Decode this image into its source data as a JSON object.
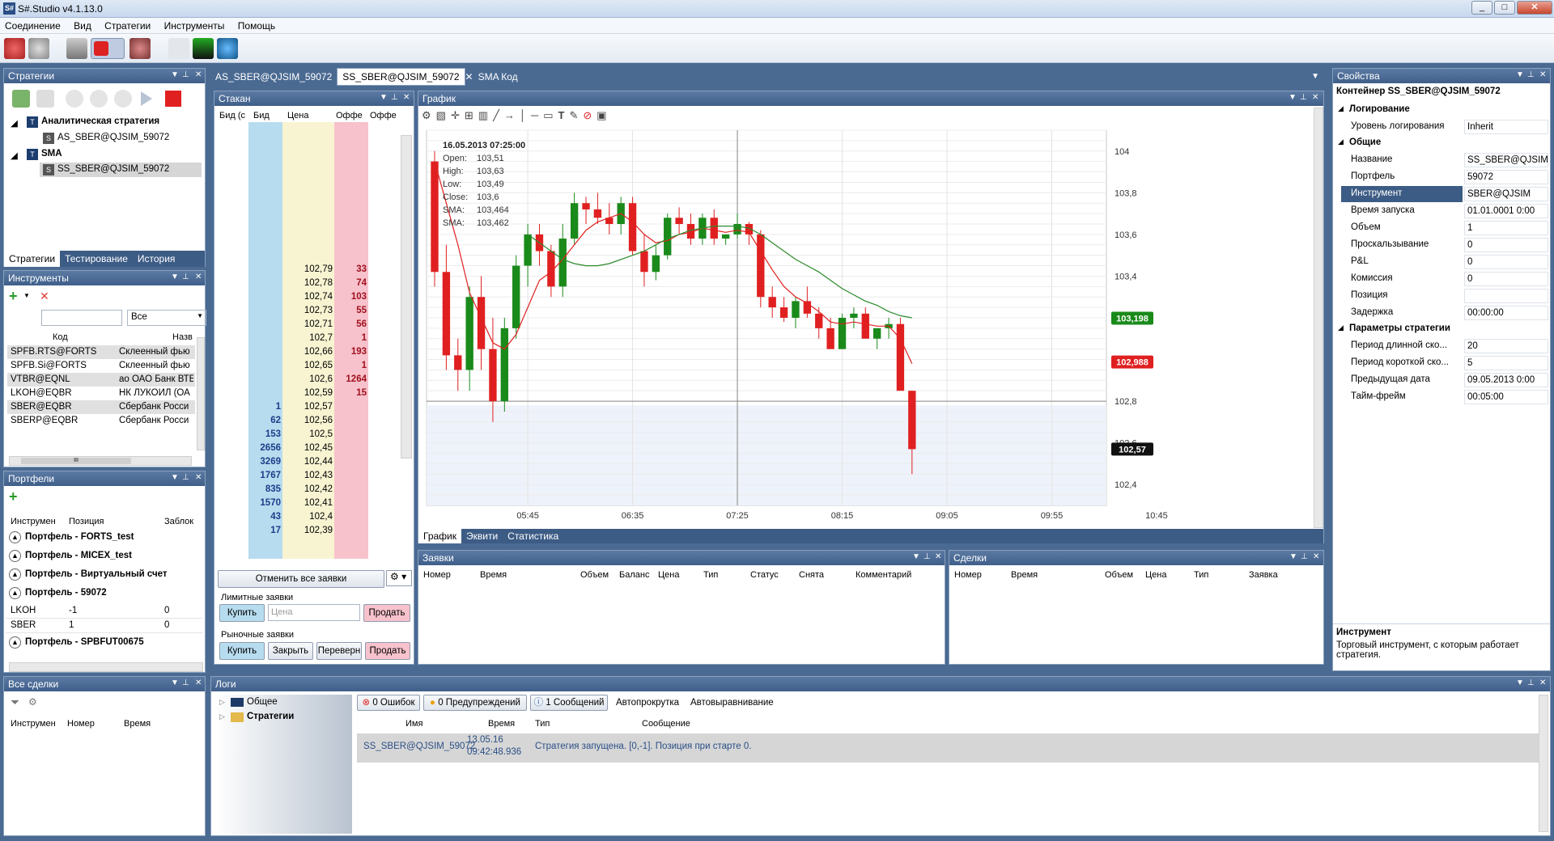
{
  "window": {
    "title": "S#.Studio v4.1.13.0",
    "min": "_",
    "max": "□",
    "close": "✕",
    "icon": "S#"
  },
  "menu": [
    "Соединение",
    "Вид",
    "Стратегии",
    "Инструменты",
    "Помощь"
  ],
  "strategies_panel": {
    "title": "Стратегии",
    "tree": [
      {
        "label": "Аналитическая стратегия",
        "bold": true,
        "child": "AS_SBER@QJSIM_59072"
      },
      {
        "label": "SMA",
        "bold": true,
        "child": "SS_SBER@QJSIM_59072"
      }
    ],
    "tabs": [
      "Стратегии",
      "Тестирование",
      "История"
    ]
  },
  "instruments_panel": {
    "title": "Инструменты",
    "filter": "Все",
    "columns": [
      "Код",
      "Назв"
    ],
    "rows": [
      [
        "SPFB.RTS@FORTS",
        "Склеенный фью"
      ],
      [
        "SPFB.Si@FORTS",
        "Склеенный фью"
      ],
      [
        "VTBR@EQNL",
        "ао ОАО Банк ВТБ"
      ],
      [
        "LKOH@EQBR",
        "НК ЛУКОЙЛ (ОА"
      ],
      [
        "SBER@EQBR",
        "Сбербанк Росси"
      ],
      [
        "SBERP@EQBR",
        "Сбербанк Росси"
      ]
    ],
    "scroll_thumb": "III"
  },
  "portfolios_panel": {
    "title": "Портфели",
    "columns": [
      "Инструмен",
      "Позиция",
      "Заблок"
    ],
    "groups": [
      {
        "name": "Портфель - FORTS_test",
        "rows": []
      },
      {
        "name": "Портфель - MICEX_test",
        "rows": []
      },
      {
        "name": "Портфель - Виртуальный счет",
        "rows": []
      },
      {
        "name": "Портфель - 59072",
        "rows": [
          [
            "LKOH",
            "-1",
            "0"
          ],
          [
            "SBER",
            "1",
            "0"
          ]
        ]
      },
      {
        "name": "Портфель - SPBFUT00675",
        "rows": []
      }
    ]
  },
  "all_trades_panel": {
    "title": "Все сделки",
    "columns": [
      "Инструмен",
      "Номер",
      "Время"
    ]
  },
  "doc_tabs": [
    "AS_SBER@QJSIM_59072",
    "SS_SBER@QJSIM_59072",
    "SMA Код"
  ],
  "orderbook": {
    "title": "Стакан",
    "columns": [
      "Бид (с",
      "Бид",
      "Цена",
      "Оффе",
      "Оффе"
    ],
    "rows": [
      {
        "bid": "",
        "price": "102,79",
        "ask": "33"
      },
      {
        "bid": "",
        "price": "102,78",
        "ask": "74"
      },
      {
        "bid": "",
        "price": "102,74",
        "ask": "103"
      },
      {
        "bid": "",
        "price": "102,73",
        "ask": "55"
      },
      {
        "bid": "",
        "price": "102,71",
        "ask": "56"
      },
      {
        "bid": "",
        "price": "102,7",
        "ask": "1"
      },
      {
        "bid": "",
        "price": "102,66",
        "ask": "193"
      },
      {
        "bid": "",
        "price": "102,65",
        "ask": "1"
      },
      {
        "bid": "",
        "price": "102,6",
        "ask": "1264"
      },
      {
        "bid": "",
        "price": "102,59",
        "ask": "15"
      },
      {
        "bid": "1",
        "price": "102,57",
        "ask": ""
      },
      {
        "bid": "62",
        "price": "102,56",
        "ask": ""
      },
      {
        "bid": "153",
        "price": "102,5",
        "ask": ""
      },
      {
        "bid": "2656",
        "price": "102,45",
        "ask": ""
      },
      {
        "bid": "3269",
        "price": "102,44",
        "ask": ""
      },
      {
        "bid": "1767",
        "price": "102,43",
        "ask": ""
      },
      {
        "bid": "835",
        "price": "102,42",
        "ask": ""
      },
      {
        "bid": "1570",
        "price": "102,41",
        "ask": ""
      },
      {
        "bid": "43",
        "price": "102,4",
        "ask": ""
      },
      {
        "bid": "17",
        "price": "102,39",
        "ask": ""
      }
    ],
    "cancel_all": "Отменить все заявки",
    "limit_label": "Лимитные заявки",
    "buy": "Купить",
    "sell": "Продать",
    "price_placeholder": "Цена",
    "market_label": "Рыночные заявки",
    "close": "Закрыть",
    "reverse": "Переверн"
  },
  "chart_panel": {
    "title": "График",
    "tabs": [
      "График",
      "Эквити",
      "Статистика"
    ],
    "tooltip": {
      "date": "16.05.2013 07:25:00",
      "lines": [
        [
          "Open:",
          "103,51"
        ],
        [
          "High:",
          "103,63"
        ],
        [
          "Low:",
          "103,49"
        ],
        [
          "Close:",
          "103,6"
        ],
        [
          "SMA:",
          "103,464"
        ],
        [
          "SMA:",
          "103,462"
        ]
      ]
    },
    "price_badges": [
      {
        "text": "103,198",
        "color": "#1a8a1a"
      },
      {
        "text": "102,988",
        "color": "#e02020"
      },
      {
        "text": "102,57",
        "color": "#111111"
      }
    ]
  },
  "chart_data": {
    "type": "candlestick",
    "y_ticks": [
      "104",
      "103,8",
      "103,6",
      "103,4",
      "103,2",
      "103",
      "102,8",
      "102,6",
      "102,4"
    ],
    "x_ticks": [
      "05:45",
      "06:35",
      "07:25",
      "08:15",
      "09:05",
      "09:55",
      "10:45"
    ],
    "ylim": [
      102.3,
      104.1
    ],
    "candles": [
      [
        103.95,
        104.0,
        103.35,
        103.42
      ],
      [
        103.42,
        103.55,
        102.95,
        103.02
      ],
      [
        103.02,
        103.1,
        102.85,
        102.95
      ],
      [
        102.95,
        103.35,
        102.85,
        103.3
      ],
      [
        103.3,
        103.4,
        102.95,
        103.05
      ],
      [
        103.05,
        103.2,
        102.7,
        102.8
      ],
      [
        102.8,
        103.2,
        102.75,
        103.15
      ],
      [
        103.15,
        103.5,
        103.1,
        103.45
      ],
      [
        103.45,
        103.65,
        103.35,
        103.6
      ],
      [
        103.6,
        103.65,
        103.45,
        103.52
      ],
      [
        103.52,
        103.55,
        103.3,
        103.35
      ],
      [
        103.35,
        103.65,
        103.3,
        103.58
      ],
      [
        103.58,
        103.8,
        103.55,
        103.75
      ],
      [
        103.75,
        103.78,
        103.65,
        103.72
      ],
      [
        103.72,
        103.8,
        103.65,
        103.68
      ],
      [
        103.68,
        103.75,
        103.6,
        103.65
      ],
      [
        103.65,
        103.78,
        103.6,
        103.75
      ],
      [
        103.75,
        103.78,
        103.5,
        103.52
      ],
      [
        103.52,
        103.6,
        103.35,
        103.42
      ],
      [
        103.42,
        103.55,
        103.38,
        103.5
      ],
      [
        103.5,
        103.7,
        103.48,
        103.68
      ],
      [
        103.68,
        103.73,
        103.6,
        103.65
      ],
      [
        103.65,
        103.7,
        103.55,
        103.58
      ],
      [
        103.58,
        103.7,
        103.55,
        103.68
      ],
      [
        103.68,
        103.72,
        103.55,
        103.58
      ],
      [
        103.58,
        103.6,
        103.55,
        103.6
      ],
      [
        103.6,
        103.7,
        103.58,
        103.65
      ],
      [
        103.65,
        103.66,
        103.55,
        103.6
      ],
      [
        103.6,
        103.62,
        103.25,
        103.3
      ],
      [
        103.3,
        103.35,
        103.2,
        103.25
      ],
      [
        103.25,
        103.3,
        103.18,
        103.2
      ],
      [
        103.2,
        103.3,
        103.15,
        103.28
      ],
      [
        103.28,
        103.35,
        103.2,
        103.22
      ],
      [
        103.22,
        103.25,
        103.1,
        103.15
      ],
      [
        103.15,
        103.2,
        103.05,
        103.05
      ],
      [
        103.05,
        103.22,
        103.05,
        103.2
      ],
      [
        103.2,
        103.25,
        103.15,
        103.22
      ],
      [
        103.22,
        103.25,
        103.1,
        103.1
      ],
      [
        103.1,
        103.15,
        103.05,
        103.15
      ],
      [
        103.15,
        103.2,
        103.1,
        103.17
      ],
      [
        103.17,
        103.2,
        103.0,
        102.85
      ],
      [
        102.85,
        102.85,
        102.45,
        102.57
      ]
    ],
    "sma_fast": [
      103.95,
      103.75,
      103.55,
      103.32,
      103.2,
      103.08,
      103.05,
      103.12,
      103.25,
      103.38,
      103.42,
      103.48,
      103.55,
      103.62,
      103.66,
      103.68,
      103.7,
      103.66,
      103.6,
      103.56,
      103.57,
      103.6,
      103.61,
      103.63,
      103.62,
      103.61,
      103.62,
      103.61,
      103.52,
      103.43,
      103.35,
      103.3,
      103.27,
      103.23,
      103.18,
      103.17,
      103.18,
      103.17,
      103.16,
      103.16,
      103.1,
      102.98
    ],
    "sma_slow": [
      null,
      null,
      null,
      null,
      null,
      null,
      null,
      null,
      103.6,
      103.56,
      103.52,
      103.48,
      103.46,
      103.45,
      103.45,
      103.46,
      103.48,
      103.5,
      103.52,
      103.55,
      103.58,
      103.6,
      103.62,
      103.63,
      103.64,
      103.64,
      103.64,
      103.63,
      103.6,
      103.56,
      103.52,
      103.48,
      103.45,
      103.42,
      103.38,
      103.34,
      103.31,
      103.28,
      103.26,
      103.23,
      103.21,
      103.2
    ]
  },
  "orders_panel": {
    "title": "Заявки",
    "columns": [
      "Номер",
      "Время",
      "Объем",
      "Баланс",
      "Цена",
      "Тип",
      "Статус",
      "Снята",
      "Комментарий"
    ]
  },
  "deals_panel": {
    "title": "Сделки",
    "columns": [
      "Номер",
      "Время",
      "Объем",
      "Цена",
      "Тип",
      "Заявка"
    ]
  },
  "logs_panel": {
    "title": "Логи",
    "tree": [
      "Общее",
      "Стратегии"
    ],
    "filters": [
      "0 Ошибок",
      "0 Предупреждений",
      "1 Сообщений"
    ],
    "toggles": [
      "Автопрокрутка",
      "Автовыравнивание"
    ],
    "columns": [
      "Имя",
      "Время",
      "Тип",
      "Сообщение"
    ],
    "rows": [
      {
        "name": "SS_SBER@QJSIM_59072",
        "date": "13.05.16",
        "time": "09:42:48.936",
        "type": "",
        "message": "Стратегия запущена. [0,-1]. Позиция при старте 0."
      }
    ]
  },
  "properties_panel": {
    "title": "Свойства",
    "container": "Контейнер  SS_SBER@QJSIM_59072",
    "sections": [
      {
        "name": "Логирование",
        "props": [
          [
            "Уровень логирования",
            "Inherit"
          ]
        ]
      },
      {
        "name": "Общие",
        "props": [
          [
            "Название",
            "SS_SBER@QJSIM_5"
          ],
          [
            "Портфель",
            "59072"
          ],
          [
            "Инструмент",
            "SBER@QJSIM"
          ],
          [
            "Время запуска",
            "01.01.0001 0:00"
          ],
          [
            "Объем",
            "1"
          ],
          [
            "Проскальзывание",
            "0"
          ],
          [
            "P&L",
            "0"
          ],
          [
            "Комиссия",
            "0"
          ],
          [
            "Позиция",
            ""
          ],
          [
            "Задержка",
            "00:00:00"
          ]
        ]
      },
      {
        "name": "Параметры стратегии",
        "props": [
          [
            "Период длинной ско...",
            "20"
          ],
          [
            "Период короткой ско...",
            "5"
          ],
          [
            "Предыдущая дата",
            "09.05.2013 0:00"
          ],
          [
            "Тайм-фрейм",
            "00:05:00"
          ]
        ]
      }
    ],
    "help_title": "Инструмент",
    "help_text": "Торговый инструмент, с которым работает стратегия."
  }
}
